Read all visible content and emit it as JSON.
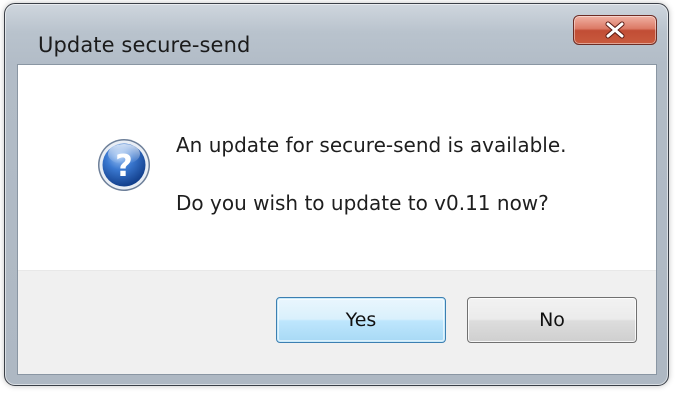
{
  "window": {
    "title": "Update secure-send",
    "close_icon": "close-icon"
  },
  "message": {
    "icon": "question-icon",
    "line1": "An update for secure-send is available.",
    "line2": "Do you wish to update to v0.11 now?"
  },
  "buttons": {
    "yes_label": "Yes",
    "no_label": "No"
  },
  "colors": {
    "close_button": "#c95a3e",
    "icon_blue": "#2a63b8",
    "default_button_border": "#3c7fb1",
    "button_area_bg": "#f0f0f0"
  }
}
